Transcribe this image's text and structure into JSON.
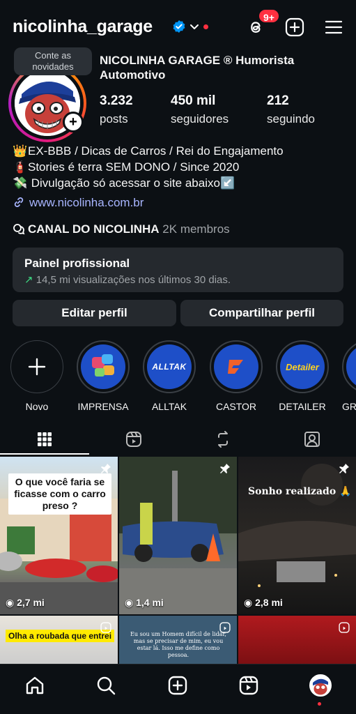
{
  "header": {
    "username": "nicolinha_garage",
    "threads_badge": "9+"
  },
  "profile": {
    "tooltip": "Conte as novidades",
    "display_name": "NICOLINHA GARAGE ®  Humorista Automotivo",
    "stats": [
      {
        "value": "3.232",
        "label": "posts"
      },
      {
        "value": "450 mil",
        "label": "seguidores"
      },
      {
        "value": "212",
        "label": "seguindo"
      }
    ],
    "bio": [
      "EX-BBB / Dicas de Carros / Rei do Engajamento",
      "Stories é terra SEM DONO / Since 2020",
      " Divulgação só acessar o site abaixo"
    ],
    "link": "www.nicolinha.com.br",
    "channel_name": "CANAL DO NICOLINHA",
    "channel_members": " 2K membros"
  },
  "panel": {
    "title": "Painel profissional",
    "subtitle": "14,5 mi visualizações nos últimos 30 dias."
  },
  "buttons": {
    "edit": "Editar perfil",
    "share": "Compartilhar perfil"
  },
  "highlights": [
    {
      "label": "Novo"
    },
    {
      "label": "IMPRENSA"
    },
    {
      "label": "ALLTAK",
      "logo_text": "ALLTAK"
    },
    {
      "label": "CASTOR"
    },
    {
      "label": "DETAILER",
      "logo_text": "Detailer"
    },
    {
      "label": "GR"
    }
  ],
  "posts": [
    {
      "views": "2,7 mi",
      "caption": "O que você faria se ficasse com o carro preso ?",
      "pinned": true
    },
    {
      "views": "1,4 mi",
      "caption": "",
      "pinned": true
    },
    {
      "views": "2,8 mi",
      "caption": "Sonho realizado 🙏",
      "pinned": true
    },
    {
      "caption": "Olha a roubada que entrei",
      "reel": true
    },
    {
      "caption": "Eu sou um Homem difícil de lidar, mas se precisar de mim, eu vou estar lá. Isso me define como pessoa.",
      "reel": true
    },
    {
      "caption": "",
      "reel": true
    }
  ],
  "colors": {
    "background": "#0c1014",
    "surface": "#25292e",
    "link": "#a8b5ff",
    "notification": "#ff3040",
    "verified": "#0095f6",
    "highlight_blue": "#1e4fc8"
  },
  "icons": {
    "header": [
      "verified-icon",
      "chevron-down-icon",
      "threads-icon",
      "plus-square-icon",
      "menu-icon"
    ],
    "tabs": [
      "grid-icon",
      "reels-icon",
      "reposts-icon",
      "tagged-icon"
    ],
    "bottom_nav": [
      "home-icon",
      "search-icon",
      "create-icon",
      "reels-icon",
      "profile-avatar"
    ]
  }
}
